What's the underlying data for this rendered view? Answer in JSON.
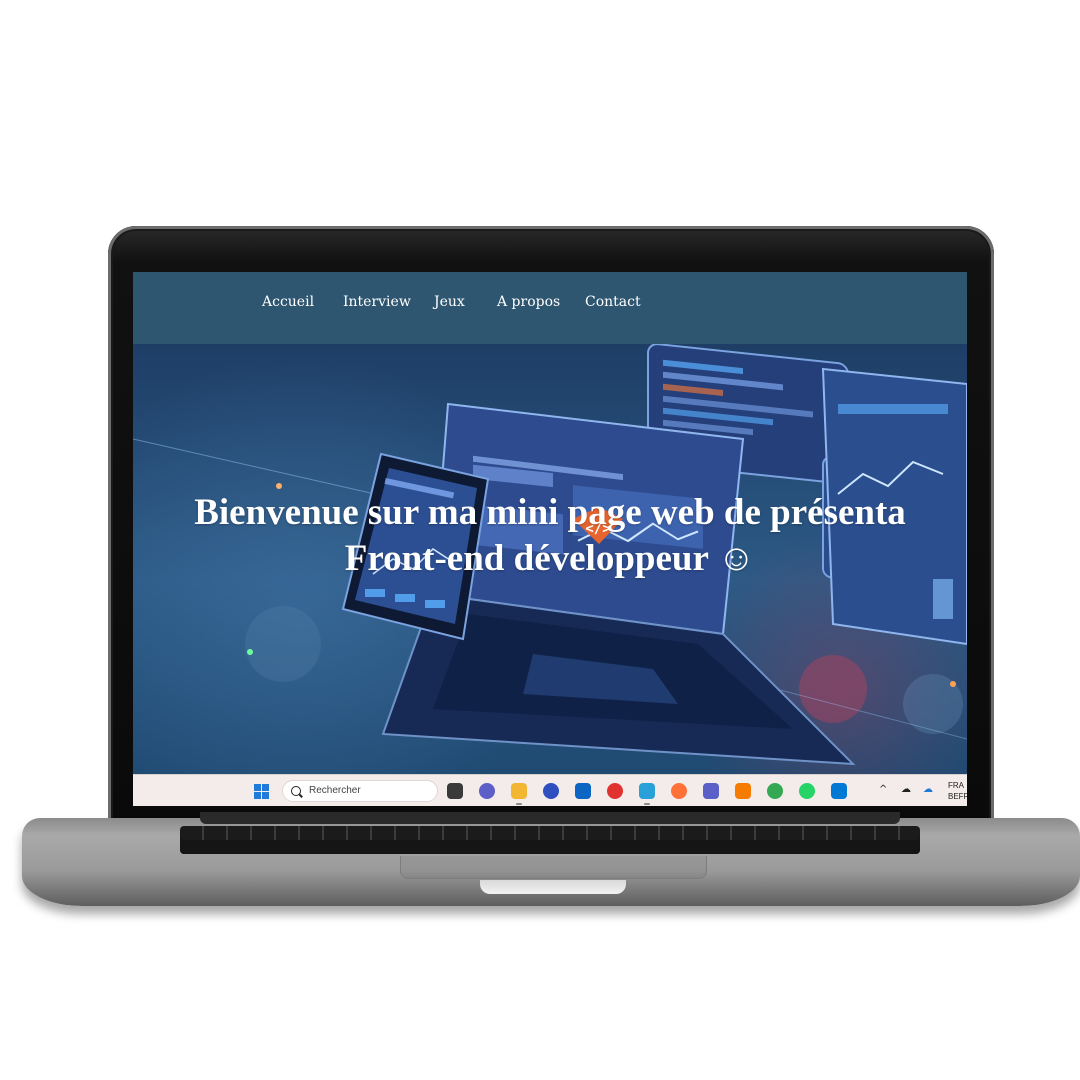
{
  "nav": {
    "items": [
      {
        "label": "Accueil"
      },
      {
        "label": "Interview"
      },
      {
        "label": "Jeux"
      },
      {
        "label": "A propos"
      },
      {
        "label": "Contact"
      }
    ]
  },
  "hero": {
    "title_line1": "Bienvenue sur ma mini page web de présenta",
    "title_line2": "Front-end développeur ☺",
    "code_badge": "</>"
  },
  "taskbar": {
    "search_placeholder": "Rechercher",
    "apps": [
      {
        "name": "task-view-icon",
        "color": "#3a3a3a"
      },
      {
        "name": "teams-chat-icon",
        "color": "#5b5fc7"
      },
      {
        "name": "file-explorer-icon",
        "color": "#f2b632"
      },
      {
        "name": "browser-app-icon",
        "color": "#2f4fc0"
      },
      {
        "name": "outlook-icon",
        "color": "#0a66c2"
      },
      {
        "name": "ccleaner-icon",
        "color": "#e0332f"
      },
      {
        "name": "snipping-tool-icon",
        "color": "#2aa0d8"
      },
      {
        "name": "firefox-icon",
        "color": "#ff7139"
      },
      {
        "name": "teams-icon",
        "color": "#5b5fc7"
      },
      {
        "name": "xampp-icon",
        "color": "#f57c00"
      },
      {
        "name": "chrome-icon",
        "color": "#34a853"
      },
      {
        "name": "whatsapp-icon",
        "color": "#25d366"
      },
      {
        "name": "vscode-icon",
        "color": "#0078d4"
      }
    ],
    "tray_chevron": "^",
    "language_line1": "FRA",
    "language_line2": "BEFR"
  },
  "colors": {
    "nav_background": "#2e5670",
    "taskbar_background": "#f3ecea",
    "accent_orange": "#e6642e"
  }
}
